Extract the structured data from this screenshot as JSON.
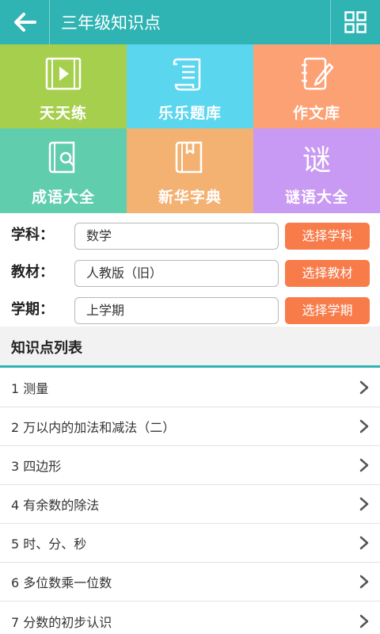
{
  "header": {
    "title": "三年级知识点",
    "back_icon": "back-arrow-icon",
    "menu_icon": "grid-icon",
    "color": "#2fb3b3"
  },
  "tiles": [
    {
      "label": "天天练",
      "icon": "video-play-icon",
      "color": "#a6cf4e"
    },
    {
      "label": "乐乐题库",
      "icon": "scroll-document-icon",
      "color": "#5ad6ee"
    },
    {
      "label": "作文库",
      "icon": "notebook-pen-icon",
      "color": "#fca174"
    },
    {
      "label": "成语大全",
      "icon": "book-search-icon",
      "color": "#60cdad"
    },
    {
      "label": "新华字典",
      "icon": "dictionary-book-icon",
      "color": "#f3b272"
    },
    {
      "label": "谜语大全",
      "icon": "riddle-character-icon",
      "glyph": "谜",
      "color": "#c99af3"
    }
  ],
  "form": {
    "subject": {
      "label": "学科：",
      "value": "数学",
      "button": "选择学科"
    },
    "textbook": {
      "label": "教材：",
      "value": "人教版（旧）",
      "button": "选择教材"
    },
    "semester": {
      "label": "学期：",
      "value": "上学期",
      "button": "选择学期"
    },
    "button_color": "#f87b4a"
  },
  "list": {
    "title": "知识点列表",
    "items": [
      "1 测量",
      "2 万以内的加法和减法（二）",
      "3 四边形",
      "4 有余数的除法",
      "5 时、分、秒",
      "6 多位数乘一位数",
      "7 分数的初步认识"
    ],
    "chevron_icon": "chevron-right-icon"
  }
}
